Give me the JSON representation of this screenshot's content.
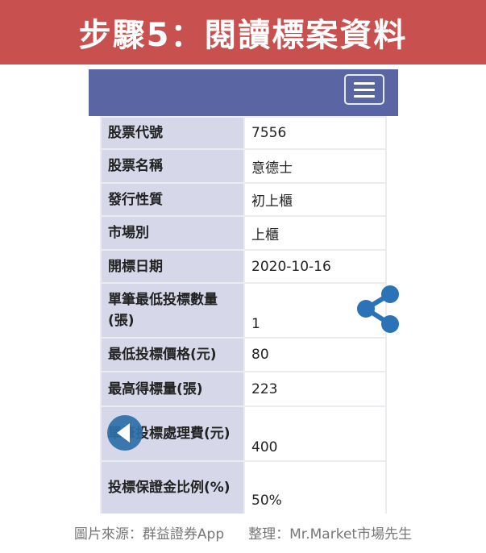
{
  "banner": {
    "title": "步驟5：閱讀標案資料"
  },
  "colors": {
    "banner": "#c8504f",
    "navbar": "#5a65a3",
    "label_bg": "#d6d8ea",
    "icon_blue": "#2b73b6"
  },
  "icons": {
    "menu": "hamburger-menu-icon",
    "share": "share-icon",
    "back": "back-arrow-icon"
  },
  "rows": [
    {
      "label": "股票代號",
      "value": "7556"
    },
    {
      "label": "股票名稱",
      "value": "意德士"
    },
    {
      "label": "發行性質",
      "value": "初上櫃"
    },
    {
      "label": "市場別",
      "value": "上櫃"
    },
    {
      "label": "開標日期",
      "value": "2020-10-16"
    },
    {
      "label": "單筆最低投標數量(張)",
      "value": "1"
    },
    {
      "label": "最低投標價格(元)",
      "value": "80"
    },
    {
      "label": "最高得標量(張)",
      "value": "223"
    },
    {
      "label": "單筆投標處理費(元)",
      "value": "400"
    },
    {
      "label": "投標保證金比例(%)",
      "value": "50%"
    }
  ],
  "caption": {
    "source": "圖片來源：群益證券App",
    "editor": "整理：Mr.Market市場先生"
  }
}
